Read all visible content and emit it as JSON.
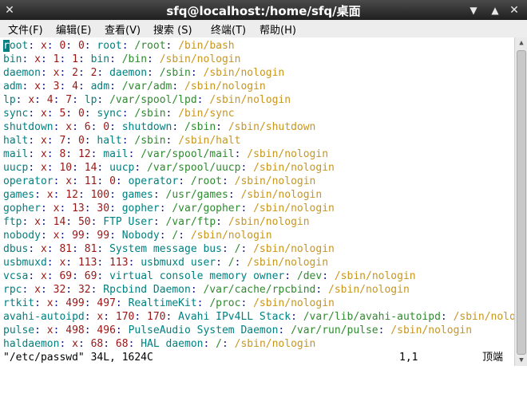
{
  "window": {
    "title": "sfq@localhost:/home/sfq/桌面",
    "close_glyph": "✕",
    "minimize_glyph": "▼",
    "maximize_glyph": "▲"
  },
  "menu": {
    "items": [
      {
        "label": "文件(F)"
      },
      {
        "label": "编辑(E)"
      },
      {
        "label": "查看(V)"
      },
      {
        "label": "搜索 (S)"
      },
      {
        "label": "终端(T)"
      },
      {
        "label": "帮助(H)"
      }
    ]
  },
  "terminal": {
    "lines": [
      [
        "root",
        "x",
        "0",
        "0",
        "root",
        "/root",
        "/bin/bash"
      ],
      [
        "bin",
        "x",
        "1",
        "1",
        "bin",
        "/bin",
        "/sbin/nologin"
      ],
      [
        "daemon",
        "x",
        "2",
        "2",
        "daemon",
        "/sbin",
        "/sbin/nologin"
      ],
      [
        "adm",
        "x",
        "3",
        "4",
        "adm",
        "/var/adm",
        "/sbin/nologin"
      ],
      [
        "lp",
        "x",
        "4",
        "7",
        "lp",
        "/var/spool/lpd",
        "/sbin/nologin"
      ],
      [
        "sync",
        "x",
        "5",
        "0",
        "sync",
        "/sbin",
        "/bin/sync"
      ],
      [
        "shutdown",
        "x",
        "6",
        "0",
        "shutdown",
        "/sbin",
        "/sbin/shutdown"
      ],
      [
        "halt",
        "x",
        "7",
        "0",
        "halt",
        "/sbin",
        "/sbin/halt"
      ],
      [
        "mail",
        "x",
        "8",
        "12",
        "mail",
        "/var/spool/mail",
        "/sbin/nologin"
      ],
      [
        "uucp",
        "x",
        "10",
        "14",
        "uucp",
        "/var/spool/uucp",
        "/sbin/nologin"
      ],
      [
        "operator",
        "x",
        "11",
        "0",
        "operator",
        "/root",
        "/sbin/nologin"
      ],
      [
        "games",
        "x",
        "12",
        "100",
        "games",
        "/usr/games",
        "/sbin/nologin"
      ],
      [
        "gopher",
        "x",
        "13",
        "30",
        "gopher",
        "/var/gopher",
        "/sbin/nologin"
      ],
      [
        "ftp",
        "x",
        "14",
        "50",
        "FTP User",
        "/var/ftp",
        "/sbin/nologin"
      ],
      [
        "nobody",
        "x",
        "99",
        "99",
        "Nobody",
        "/",
        "/sbin/nologin"
      ],
      [
        "dbus",
        "x",
        "81",
        "81",
        "System message bus",
        "/",
        "/sbin/nologin"
      ],
      [
        "usbmuxd",
        "x",
        "113",
        "113",
        "usbmuxd user",
        "/",
        "/sbin/nologin"
      ],
      [
        "vcsa",
        "x",
        "69",
        "69",
        "virtual console memory owner",
        "/dev",
        "/sbin/nologin"
      ],
      [
        "rpc",
        "x",
        "32",
        "32",
        "Rpcbind Daemon",
        "/var/cache/rpcbind",
        "/sbin/nologin"
      ],
      [
        "rtkit",
        "x",
        "499",
        "497",
        "RealtimeKit",
        "/proc",
        "/sbin/nologin"
      ],
      [
        "avahi-autoipd",
        "x",
        "170",
        "170",
        "Avahi IPv4LL Stack",
        "/var/lib/avahi-autoipd",
        "/sbin/nologin"
      ],
      [
        "pulse",
        "x",
        "498",
        "496",
        "PulseAudio System Daemon",
        "/var/run/pulse",
        "/sbin/nologin"
      ],
      [
        "haldaemon",
        "x",
        "68",
        "68",
        "HAL daemon",
        "/",
        "/sbin/nologin"
      ]
    ]
  },
  "status": {
    "file_info": "\"/etc/passwd\" 34L, 1624C",
    "cursor_position": "1,1",
    "scroll_position": "顶端"
  },
  "colors": {
    "username": "#008080",
    "separator": "#1c1c8c",
    "id_field": "#9a1515",
    "home": "#2e8b2e",
    "shell": "#c8961e"
  }
}
